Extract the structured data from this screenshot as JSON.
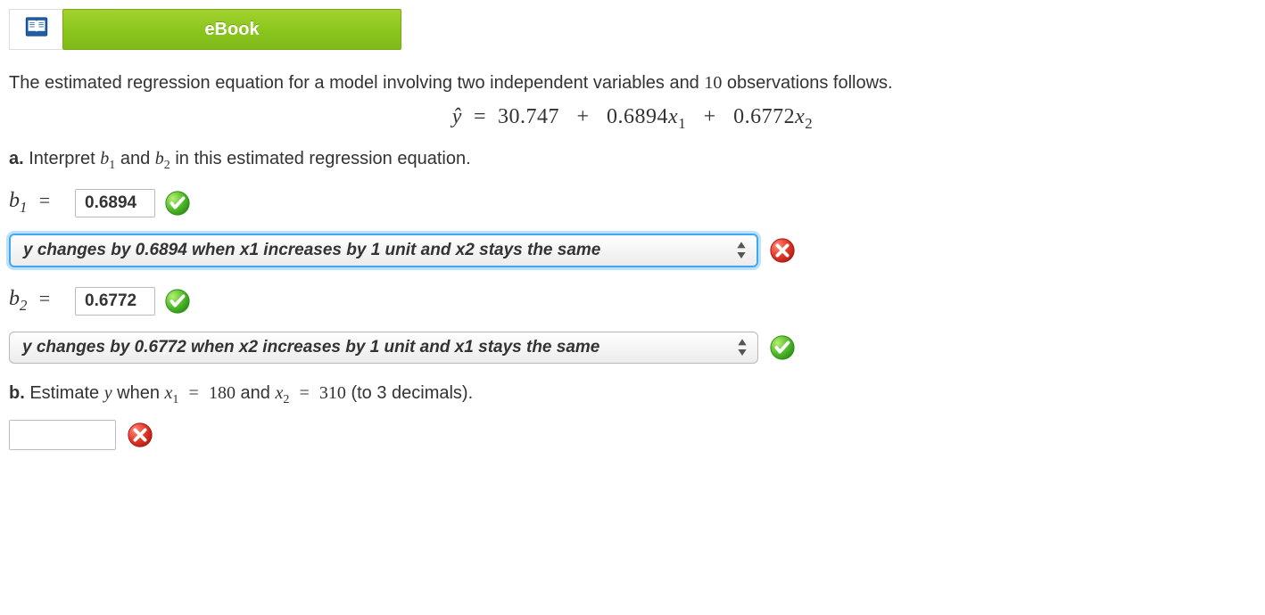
{
  "ebook_label": "eBook",
  "intro_prefix": "The estimated regression equation for a model involving two independent variables and ",
  "intro_n": "10",
  "intro_suffix": " observations follows.",
  "equation": {
    "lhs_hat": "ŷ",
    "eq": "=",
    "intercept": "30.747",
    "plus1": "+",
    "b1": "0.6894",
    "x1": "x",
    "x1_sub": "1",
    "plus2": "+",
    "b2": "0.6772",
    "x2": "x",
    "x2_sub": "2"
  },
  "part_a": {
    "label": "a.",
    "text_prefix": " Interpret ",
    "b1": "b",
    "b1_sub": "1",
    "and": " and ",
    "b2": "b",
    "b2_sub": "2",
    "text_suffix": "  in this estimated regression equation."
  },
  "b1_row": {
    "var": "b",
    "sub": "1",
    "eq": "=",
    "value": "0.6894"
  },
  "select_b1": "y changes by 0.6894 when x1 increases by 1 unit and x2 stays the same",
  "b2_row": {
    "var": "b",
    "sub": "2",
    "eq": "=",
    "value": "0.6772"
  },
  "select_b2": "y changes by 0.6772 when x2 increases by 1 unit and x1 stays the same",
  "part_b": {
    "label": "b.",
    "prefix": " Estimate ",
    "y": "y",
    "when": " when ",
    "x1": "x",
    "x1_sub": "1",
    "eq1": "=",
    "v1": "180",
    "and": " and ",
    "x2": "x",
    "x2_sub": "2",
    "eq2": "=",
    "v2": "310",
    "suffix": " (to 3 decimals)."
  },
  "answer_b_value": ""
}
